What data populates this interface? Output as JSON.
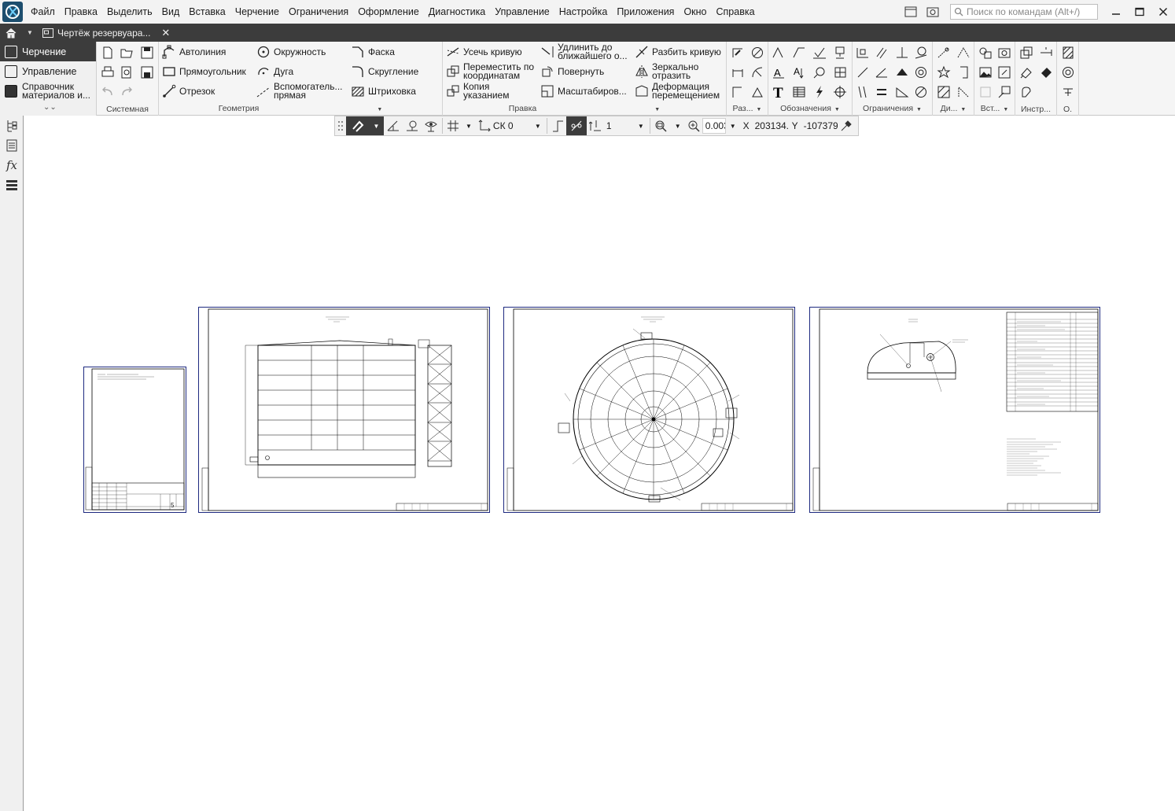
{
  "menu": {
    "items": [
      "Файл",
      "Правка",
      "Выделить",
      "Вид",
      "Вставка",
      "Черчение",
      "Ограничения",
      "Оформление",
      "Диагностика",
      "Управление",
      "Настройка",
      "Приложения",
      "Окно",
      "Справка"
    ],
    "search_placeholder": "Поиск по командам (Alt+/)"
  },
  "tabs": {
    "document_title": "Чертёж резервуара...",
    "close_symbol": "✕"
  },
  "modes": {
    "items": [
      "Черчение",
      "Управление",
      "Справочник материалов и..."
    ]
  },
  "ribbon": {
    "groups": {
      "system": "Системная",
      "geometry": "Геометрия",
      "edit": "Правка",
      "dims": "Раз...",
      "notation": "Обозначения",
      "constraints": "Ограничения",
      "di": "Ди...",
      "insert": "Вст...",
      "tools": "Инстр...",
      "o": "О."
    },
    "geometry": {
      "autoline": "Автолиния",
      "rectangle": "Прямоугольник",
      "segment": "Отрезок",
      "circle": "Окружность",
      "arc": "Дуга",
      "aux_line": "Вспомогатель... прямая",
      "chamfer": "Фаска",
      "fillet": "Скругление",
      "hatch": "Штриховка"
    },
    "edit": {
      "trim": "Усечь кривую",
      "move_coords": "Переместить по координатам",
      "copy": "Копия указанием",
      "extend": "Удлинить до ближайшего о...",
      "rotate": "Повернуть",
      "scale": "Масштабиров...",
      "split": "Разбить кривую",
      "mirror": "Зеркально отразить",
      "deform": "Деформация перемещением"
    }
  },
  "viewbar": {
    "cs": "СК 0",
    "layer": "1",
    "zoom": "0.003",
    "x_label": "X",
    "x_value": "203134.4",
    "y_label": "Y",
    "y_value": "-107379"
  },
  "left_panel": {
    "fx_label": "fx"
  },
  "sheet_title_block_num": "5"
}
